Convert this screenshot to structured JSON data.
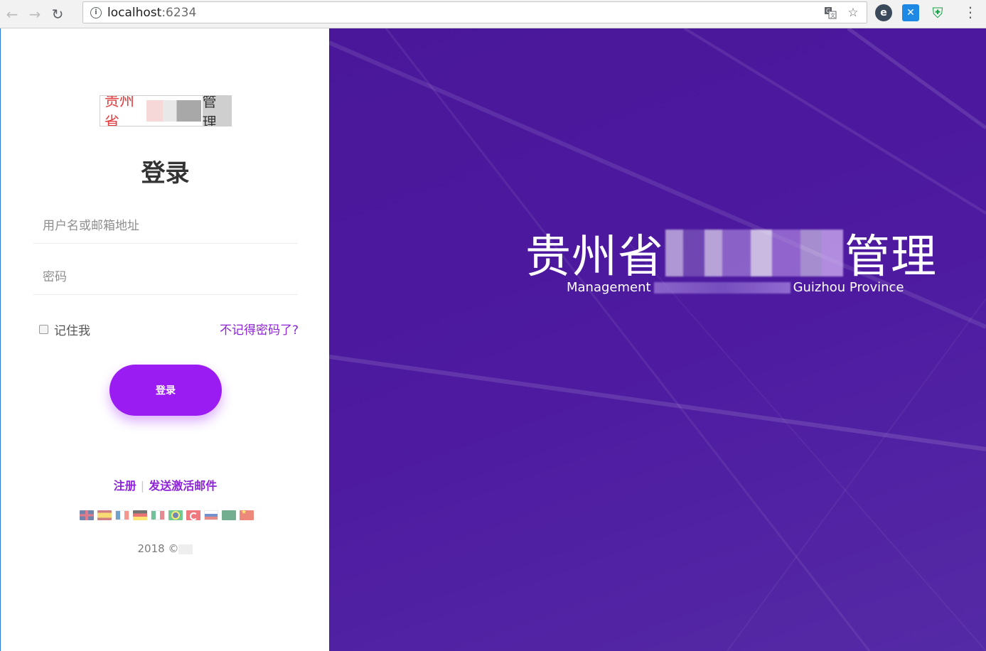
{
  "browser": {
    "url_host": "localhost",
    "url_port": ":6234"
  },
  "login": {
    "logo_text_red": "贵州省",
    "logo_text_gray": "管理",
    "title": "登录",
    "username_placeholder": "用户名或邮箱地址",
    "password_placeholder": "密码",
    "remember_label": "记住我",
    "forgot_link": "不记得密码了?",
    "submit_label": "登录",
    "register_link": "注册",
    "separator": "|",
    "activation_link": "发送激活邮件",
    "copyright": "2018 ©"
  },
  "languages": [
    "gb",
    "es",
    "fr",
    "de",
    "it",
    "br",
    "tr",
    "ru",
    "sa",
    "cn"
  ],
  "hero": {
    "title_start": "贵州省",
    "title_end": "管理",
    "subtitle_start": "Management",
    "subtitle_end": "Guizhou Province"
  },
  "colors": {
    "accent": "#9b1cf3",
    "link": "#8e24d8",
    "hero_background": "#4a179a"
  }
}
